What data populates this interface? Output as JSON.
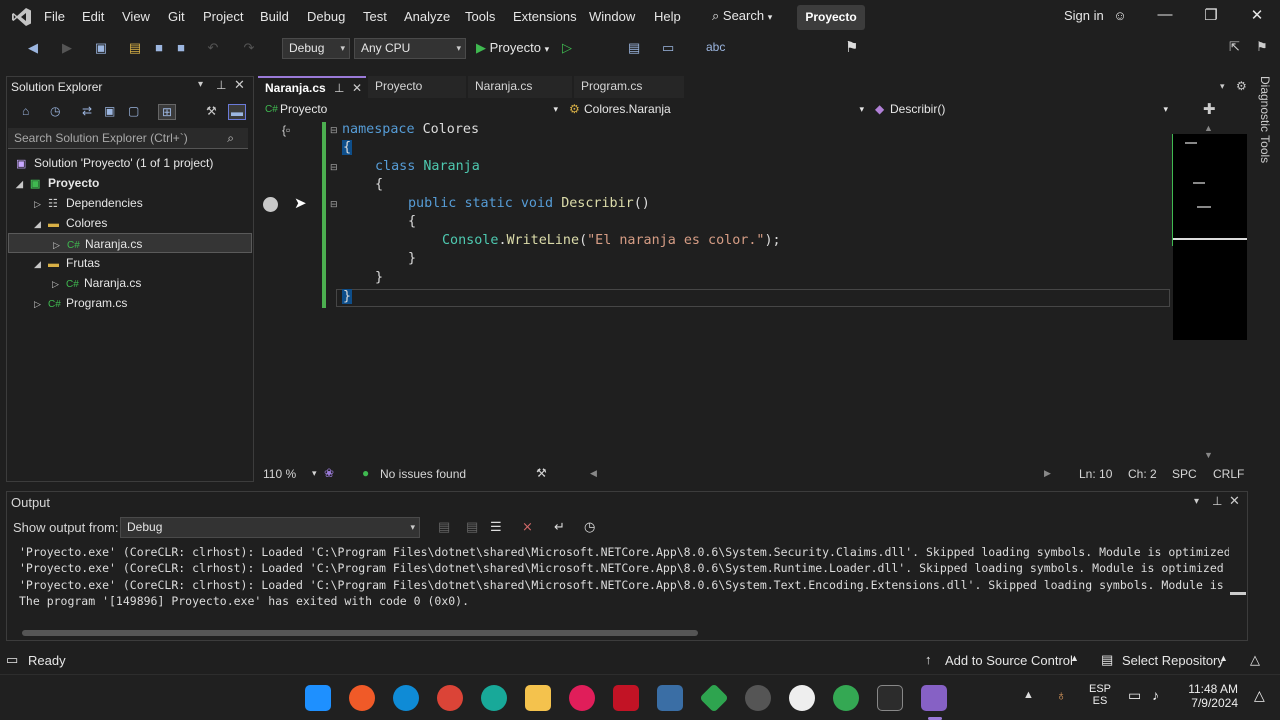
{
  "menubar": {
    "items": [
      "File",
      "Edit",
      "View",
      "Git",
      "Project",
      "Build",
      "Debug",
      "Test",
      "Analyze",
      "Tools",
      "Extensions",
      "Window",
      "Help"
    ],
    "search_label": "Search",
    "project_badge": "Proyecto",
    "signin": "Sign in"
  },
  "toolbar": {
    "config": "Debug",
    "platform": "Any CPU",
    "run_label": "Proyecto"
  },
  "solution_explorer": {
    "title": "Solution Explorer",
    "search_placeholder": "Search Solution Explorer (Ctrl+`)",
    "items": [
      {
        "label": "Solution 'Proyecto' (1 of 1 project)",
        "icon": "solution-icon"
      },
      {
        "label": "Proyecto",
        "icon": "csharp-project-icon"
      },
      {
        "label": "Dependencies",
        "icon": "dependencies-icon"
      },
      {
        "label": "Colores",
        "icon": "folder-icon"
      },
      {
        "label": "Naranja.cs",
        "icon": "csharp-file-icon"
      },
      {
        "label": "Frutas",
        "icon": "folder-icon"
      },
      {
        "label": "Naranja.cs",
        "icon": "csharp-file-icon"
      },
      {
        "label": "Program.cs",
        "icon": "csharp-file-icon"
      }
    ]
  },
  "tabs": [
    "Naranja.cs",
    "Proyecto",
    "Naranja.cs",
    "Program.cs"
  ],
  "navbar": {
    "project": "Proyecto",
    "type": "Colores.Naranja",
    "member": "Describir()"
  },
  "code": {
    "line1_kw": "namespace",
    "line1_name": "Colores",
    "line2": "{",
    "line3_kw": "class",
    "line3_name": "Naranja",
    "line4": "{",
    "line5_kw1": "public",
    "line5_kw2": "static",
    "line5_kw3": "void",
    "line5_fn": "Describir",
    "line5_paren": "()",
    "line6": "{",
    "line7_type": "Console",
    "line7_dot": ".",
    "line7_fn": "WriteLine",
    "line7_open": "(",
    "line7_str": "\"El naranja es color.\"",
    "line7_close": ");",
    "line8": "}",
    "line9": "}",
    "line10": "}"
  },
  "side_label": "Diagnostic Tools",
  "editor_status": {
    "zoom": "110 %",
    "issues": "No issues found",
    "line": "Ln: 10",
    "col": "Ch: 2",
    "spc": "SPC",
    "crlf": "CRLF"
  },
  "output": {
    "title": "Output",
    "show_from_label": "Show output from:",
    "source": "Debug",
    "lines": [
      "'Proyecto.exe' (CoreCLR: clrhost): Loaded 'C:\\Program Files\\dotnet\\shared\\Microsoft.NETCore.App\\8.0.6\\System.Security.Claims.dll'. Skipped loading symbols. Module is optimized and th",
      "'Proyecto.exe' (CoreCLR: clrhost): Loaded 'C:\\Program Files\\dotnet\\shared\\Microsoft.NETCore.App\\8.0.6\\System.Runtime.Loader.dll'. Skipped loading symbols. Module is optimized and the",
      "'Proyecto.exe' (CoreCLR: clrhost): Loaded 'C:\\Program Files\\dotnet\\shared\\Microsoft.NETCore.App\\8.0.6\\System.Text.Encoding.Extensions.dll'. Skipped loading symbols. Module is optimi",
      "The program '[149896] Proyecto.exe' has exited with code 0 (0x0)."
    ]
  },
  "statusbar": {
    "ready": "Ready",
    "source_control": "Add to Source Control",
    "repo": "Select Repository"
  },
  "taskbar": {
    "lang1": "ESP",
    "lang2": "ES",
    "time": "11:48 AM",
    "date": "7/9/2024"
  },
  "colors": {
    "accent": "#9a7ad8",
    "keyword": "#569cd6",
    "type": "#4ec9b0",
    "method": "#dcdcaa",
    "string": "#d69d85",
    "change_bar": "#4caf50"
  }
}
